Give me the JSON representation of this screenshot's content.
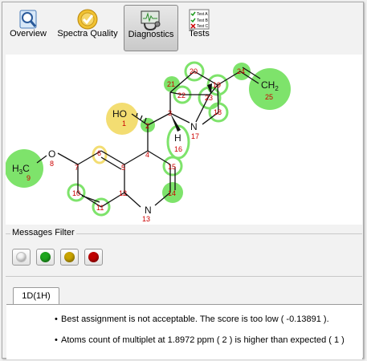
{
  "toolbar": {
    "buttons": [
      {
        "label": "Overview",
        "icon": "overview-icon",
        "active": false
      },
      {
        "label": "Spectra Quality",
        "icon": "spectra-quality-icon",
        "active": false
      },
      {
        "label": "Diagnostics",
        "icon": "diagnostics-icon",
        "active": true
      },
      {
        "label": "Tests",
        "icon": "tests-icon",
        "active": false
      }
    ],
    "tests_icon_lines": [
      "Test A",
      "Test B",
      "Test C"
    ]
  },
  "molecule": {
    "atoms": {
      "o1": {
        "symbol": "HO",
        "number": "1"
      },
      "c2": {
        "number": "2"
      },
      "c3": {
        "number": "3"
      },
      "c4": {
        "number": "4"
      },
      "c5": {
        "number": "5"
      },
      "c6": {
        "number": "6"
      },
      "c7": {
        "number": "7"
      },
      "o8": {
        "symbol": "O",
        "number": "8"
      },
      "c9": {
        "number": "9"
      },
      "c10": {
        "number": "10"
      },
      "c11": {
        "number": "11"
      },
      "c12": {
        "number": "12"
      },
      "n13": {
        "symbol": "N",
        "number": "13"
      },
      "c14": {
        "number": "14"
      },
      "c15": {
        "number": "15"
      },
      "h16": {
        "symbol": "H",
        "number": "16"
      },
      "n17": {
        "symbol": "N",
        "number": "17"
      },
      "c18": {
        "number": "18"
      },
      "c19": {
        "number": "19"
      },
      "c20": {
        "number": "20"
      },
      "c21": {
        "number": "21"
      },
      "c22": {
        "number": "22"
      },
      "c23": {
        "number": "23"
      },
      "c24": {
        "number": "24"
      },
      "c25": {
        "number": "25"
      }
    },
    "methyl_label": {
      "h": "H",
      "sub": "3",
      "c": "C"
    },
    "vinyl_label": {
      "ch": "CH",
      "sub": "2"
    },
    "colors": {
      "highlight_green": "#7ee36b",
      "highlight_yellow": "#f3dd72",
      "atom_number": "#cc0000"
    }
  },
  "messages_filter": {
    "title": "Messages Filter",
    "buttons": [
      {
        "name": "white",
        "color": "#f4f4f4"
      },
      {
        "name": "green",
        "color": "#1fa61f"
      },
      {
        "name": "yellow",
        "color": "#c9a400"
      },
      {
        "name": "red",
        "color": "#c00000"
      }
    ]
  },
  "results": {
    "tab": "1D(1H)",
    "messages": [
      "Best assignment is not acceptable. The score is too low ( -0.13891 ).",
      "Atoms count of multiplet at 1.8972 ppm ( 2 ) is higher than expected ( 1 )"
    ]
  }
}
